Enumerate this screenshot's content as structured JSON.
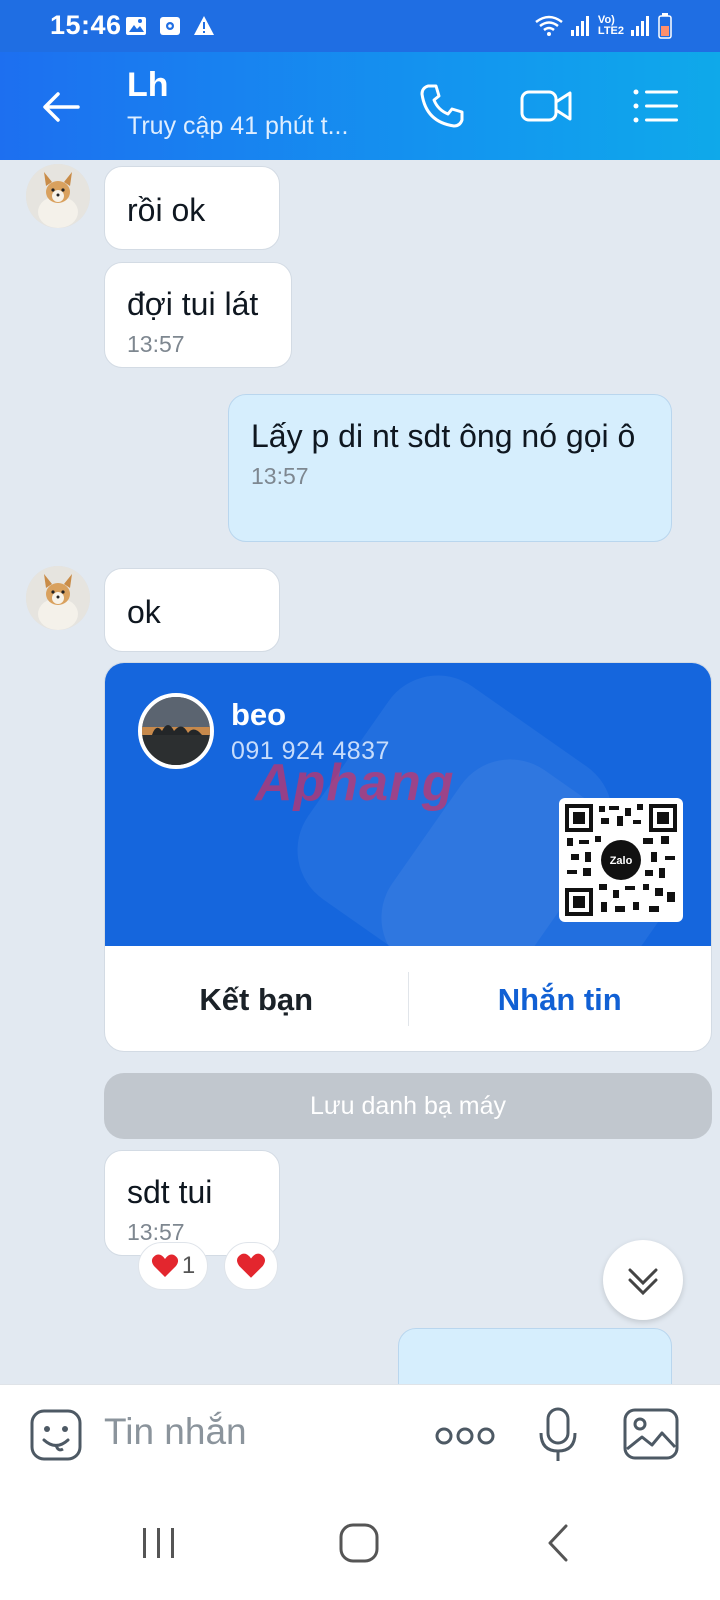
{
  "status_bar": {
    "time": "15:46",
    "network_label": "Vo)\nLTE2"
  },
  "header": {
    "title": "Lh",
    "subtitle": "Truy cập 41 phút t..."
  },
  "messages": [
    {
      "text": "rồi ok",
      "time": ""
    },
    {
      "text": "đợi tui lát",
      "time": "13:57"
    },
    {
      "text": "Lấy p di nt sdt ông nó gọi ô",
      "time": "13:57"
    },
    {
      "text": "ok",
      "time": ""
    },
    {
      "text": "sdt tui",
      "time": "13:57"
    }
  ],
  "contact_card": {
    "name": "beo",
    "phone": "091 924 4837",
    "qr_label": "Zalo",
    "add_friend_label": "Kết bạn",
    "message_label": "Nhắn tin",
    "watermark": "Aphang"
  },
  "save_contact_label": "Lưu danh bạ máy",
  "reactions": {
    "heart_count": "1"
  },
  "composer": {
    "placeholder": "Tin nhắn"
  },
  "colors": {
    "accent": "#1566dd",
    "header": "#1d6ff0",
    "bubble_me": "#d6eefd",
    "chat_bg": "#e2e9f1"
  }
}
